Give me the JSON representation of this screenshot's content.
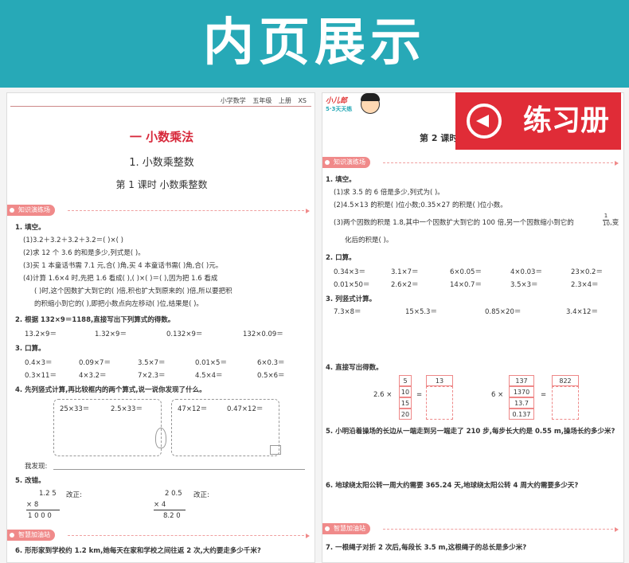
{
  "banner": {
    "title": "内页展示"
  },
  "workbook_badge": {
    "label": "练习册",
    "icon": "back-arrow-icon"
  },
  "left": {
    "header": "小学数学 五年级 上册 XS",
    "chapter": "一  小数乘法",
    "section": "1. 小数乘整数",
    "lesson": "第 1 课时  小数乘整数",
    "sect1": "知识演练场",
    "sect2": "智慧加油站",
    "q1": {
      "title": "1. 填空。",
      "l1": "(1)3.2＋3.2＋3.2＋3.2＝(     )×(     )",
      "l2": "(2)求 12 个 3.6 的和是多少,列式是(                              )。",
      "l3": "(3)买 1 本童话书需 7.1 元,合(     )角,买 4 本童话书需(     )角,合(     )元。",
      "l4": "(4)计算 1.6×4 时,先把 1.6 看成(     ),(     )×(     )＝(     ),因为把 1.6 看成",
      "l5": "(     )时,这个因数扩大到它的(     )倍,积也扩大到原来的(     )倍,所以要把积",
      "l6": "的积缩小到它的(     ),即把小数点向左移动(     )位,结果是(     )。"
    },
    "q2": {
      "title": "2. 根据 132×9＝1188,直接写出下列算式的得数。",
      "items": [
        "13.2×9＝",
        "1.32×9＝",
        "0.132×9＝",
        "132×0.09＝"
      ]
    },
    "q3": {
      "title": "3. 口算。",
      "row1": [
        "0.4×3＝",
        "0.09×7＝",
        "3.5×7＝",
        "0.01×5＝",
        "6×0.3＝"
      ],
      "row2": [
        "0.3×11＝",
        "4×3.2＝",
        "7×2.3＝",
        "4.5×4＝",
        "0.5×6＝"
      ]
    },
    "q4": {
      "title": "4. 先列竖式计算,再比较框内的两个算式,说一说你发现了什么。",
      "box1": [
        "25×33＝",
        "2.5×33＝"
      ],
      "box2": [
        "47×12＝",
        "0.47×12＝"
      ],
      "found": "我发现:"
    },
    "q5": {
      "title": "5. 改错。",
      "c1": {
        "a": "1.2 5",
        "b": "×      8",
        "r": "1 0 0 0",
        "label": "改正:"
      },
      "c2": {
        "a": "2 0.5",
        "b": "×      4",
        "r": "8.2 0",
        "label": "改正:"
      }
    },
    "q6": "6. 形形家到学校约 1.2 km,她每天在家和学校之间往返 2 次,大约要走多少千米?"
  },
  "right": {
    "logo": {
      "name": "小儿郎",
      "sub": "5·3天天练"
    },
    "lesson": "第 2 课时",
    "sect1": "知识演练场",
    "sect2": "智慧加油站",
    "q1": {
      "title": "1. 填空。",
      "l1": "(1)求 3.5 的 6 倍是多少,列式为(                    )。",
      "l2": "(2)4.5×13 的积是(     )位小数;0.35×27 的积是(     )位小数。",
      "l3": "(3)两个因数的积是 1.8,其中一个因数扩大到它的 100 倍,另一个因数缩小到它的",
      "l3frac": {
        "num": "1",
        "den": "10"
      },
      "l3end": ",变",
      "l4": "化后的积是(          )。"
    },
    "q2": {
      "title": "2. 口算。",
      "row1": [
        "0.34×3＝",
        "3.1×7＝",
        "6×0.05＝",
        "4×0.03＝",
        "23×0.2＝"
      ],
      "row2": [
        "0.01×50＝",
        "2.6×2＝",
        "14×0.7＝",
        "3.5×3＝",
        "2.3×4＝"
      ]
    },
    "q3": {
      "title": "3. 列竖式计算。",
      "items": [
        "7.3×8＝",
        "15×5.3＝",
        "0.85×20＝",
        "3.4×12＝"
      ]
    },
    "q4": {
      "title": "4. 直接写出得数。",
      "g1": {
        "mult": "2.6  ×",
        "list": [
          "5",
          "10",
          "15",
          "20"
        ],
        "first": "13"
      },
      "g2": {
        "mult": "6  ×",
        "list": [
          "137",
          "1370",
          "13.7",
          "0.137"
        ],
        "first": "822"
      }
    },
    "q5": "5. 小明沿着操场的长边从一端走到另一端走了 210 步,每步长大约是 0.55 m,操场长约多少米?",
    "q6": "6. 地球绕太阳公转一周大约需要 365.24 天,地球绕太阳公转 4 周大约需要多少天?",
    "q7": "7. 一根绳子对折 2 次后,每段长 3.5 m,这根绳子的总长是多少米?"
  }
}
